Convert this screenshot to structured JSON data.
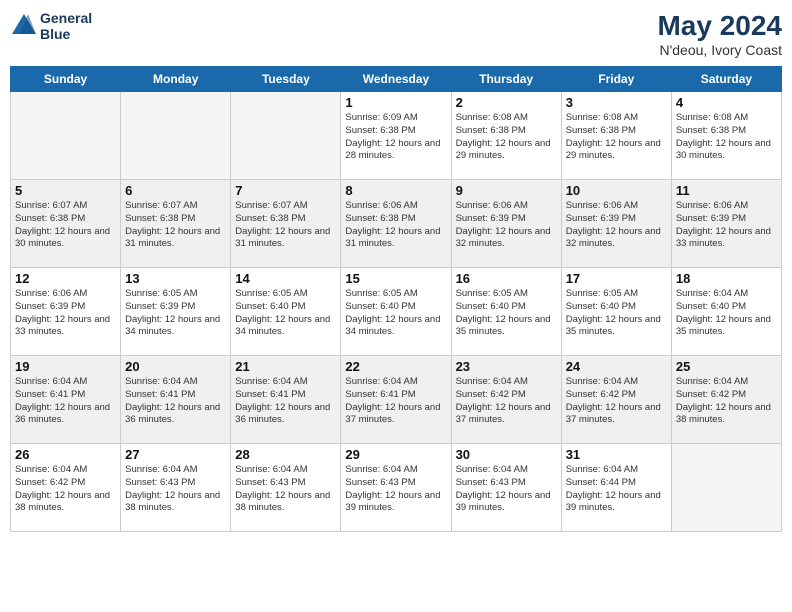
{
  "header": {
    "logo_line1": "General",
    "logo_line2": "Blue",
    "month_year": "May 2024",
    "location": "N'deou, Ivory Coast"
  },
  "day_headers": [
    "Sunday",
    "Monday",
    "Tuesday",
    "Wednesday",
    "Thursday",
    "Friday",
    "Saturday"
  ],
  "weeks": [
    [
      {
        "day": "",
        "info": "",
        "empty": true
      },
      {
        "day": "",
        "info": "",
        "empty": true
      },
      {
        "day": "",
        "info": "",
        "empty": true
      },
      {
        "day": "1",
        "info": "Sunrise: 6:09 AM\nSunset: 6:38 PM\nDaylight: 12 hours\nand 28 minutes.",
        "empty": false
      },
      {
        "day": "2",
        "info": "Sunrise: 6:08 AM\nSunset: 6:38 PM\nDaylight: 12 hours\nand 29 minutes.",
        "empty": false
      },
      {
        "day": "3",
        "info": "Sunrise: 6:08 AM\nSunset: 6:38 PM\nDaylight: 12 hours\nand 29 minutes.",
        "empty": false
      },
      {
        "day": "4",
        "info": "Sunrise: 6:08 AM\nSunset: 6:38 PM\nDaylight: 12 hours\nand 30 minutes.",
        "empty": false
      }
    ],
    [
      {
        "day": "5",
        "info": "Sunrise: 6:07 AM\nSunset: 6:38 PM\nDaylight: 12 hours\nand 30 minutes.",
        "empty": false
      },
      {
        "day": "6",
        "info": "Sunrise: 6:07 AM\nSunset: 6:38 PM\nDaylight: 12 hours\nand 31 minutes.",
        "empty": false
      },
      {
        "day": "7",
        "info": "Sunrise: 6:07 AM\nSunset: 6:38 PM\nDaylight: 12 hours\nand 31 minutes.",
        "empty": false
      },
      {
        "day": "8",
        "info": "Sunrise: 6:06 AM\nSunset: 6:38 PM\nDaylight: 12 hours\nand 31 minutes.",
        "empty": false
      },
      {
        "day": "9",
        "info": "Sunrise: 6:06 AM\nSunset: 6:39 PM\nDaylight: 12 hours\nand 32 minutes.",
        "empty": false
      },
      {
        "day": "10",
        "info": "Sunrise: 6:06 AM\nSunset: 6:39 PM\nDaylight: 12 hours\nand 32 minutes.",
        "empty": false
      },
      {
        "day": "11",
        "info": "Sunrise: 6:06 AM\nSunset: 6:39 PM\nDaylight: 12 hours\nand 33 minutes.",
        "empty": false
      }
    ],
    [
      {
        "day": "12",
        "info": "Sunrise: 6:06 AM\nSunset: 6:39 PM\nDaylight: 12 hours\nand 33 minutes.",
        "empty": false
      },
      {
        "day": "13",
        "info": "Sunrise: 6:05 AM\nSunset: 6:39 PM\nDaylight: 12 hours\nand 34 minutes.",
        "empty": false
      },
      {
        "day": "14",
        "info": "Sunrise: 6:05 AM\nSunset: 6:40 PM\nDaylight: 12 hours\nand 34 minutes.",
        "empty": false
      },
      {
        "day": "15",
        "info": "Sunrise: 6:05 AM\nSunset: 6:40 PM\nDaylight: 12 hours\nand 34 minutes.",
        "empty": false
      },
      {
        "day": "16",
        "info": "Sunrise: 6:05 AM\nSunset: 6:40 PM\nDaylight: 12 hours\nand 35 minutes.",
        "empty": false
      },
      {
        "day": "17",
        "info": "Sunrise: 6:05 AM\nSunset: 6:40 PM\nDaylight: 12 hours\nand 35 minutes.",
        "empty": false
      },
      {
        "day": "18",
        "info": "Sunrise: 6:04 AM\nSunset: 6:40 PM\nDaylight: 12 hours\nand 35 minutes.",
        "empty": false
      }
    ],
    [
      {
        "day": "19",
        "info": "Sunrise: 6:04 AM\nSunset: 6:41 PM\nDaylight: 12 hours\nand 36 minutes.",
        "empty": false
      },
      {
        "day": "20",
        "info": "Sunrise: 6:04 AM\nSunset: 6:41 PM\nDaylight: 12 hours\nand 36 minutes.",
        "empty": false
      },
      {
        "day": "21",
        "info": "Sunrise: 6:04 AM\nSunset: 6:41 PM\nDaylight: 12 hours\nand 36 minutes.",
        "empty": false
      },
      {
        "day": "22",
        "info": "Sunrise: 6:04 AM\nSunset: 6:41 PM\nDaylight: 12 hours\nand 37 minutes.",
        "empty": false
      },
      {
        "day": "23",
        "info": "Sunrise: 6:04 AM\nSunset: 6:42 PM\nDaylight: 12 hours\nand 37 minutes.",
        "empty": false
      },
      {
        "day": "24",
        "info": "Sunrise: 6:04 AM\nSunset: 6:42 PM\nDaylight: 12 hours\nand 37 minutes.",
        "empty": false
      },
      {
        "day": "25",
        "info": "Sunrise: 6:04 AM\nSunset: 6:42 PM\nDaylight: 12 hours\nand 38 minutes.",
        "empty": false
      }
    ],
    [
      {
        "day": "26",
        "info": "Sunrise: 6:04 AM\nSunset: 6:42 PM\nDaylight: 12 hours\nand 38 minutes.",
        "empty": false
      },
      {
        "day": "27",
        "info": "Sunrise: 6:04 AM\nSunset: 6:43 PM\nDaylight: 12 hours\nand 38 minutes.",
        "empty": false
      },
      {
        "day": "28",
        "info": "Sunrise: 6:04 AM\nSunset: 6:43 PM\nDaylight: 12 hours\nand 38 minutes.",
        "empty": false
      },
      {
        "day": "29",
        "info": "Sunrise: 6:04 AM\nSunset: 6:43 PM\nDaylight: 12 hours\nand 39 minutes.",
        "empty": false
      },
      {
        "day": "30",
        "info": "Sunrise: 6:04 AM\nSunset: 6:43 PM\nDaylight: 12 hours\nand 39 minutes.",
        "empty": false
      },
      {
        "day": "31",
        "info": "Sunrise: 6:04 AM\nSunset: 6:44 PM\nDaylight: 12 hours\nand 39 minutes.",
        "empty": false
      },
      {
        "day": "",
        "info": "",
        "empty": true
      }
    ]
  ]
}
